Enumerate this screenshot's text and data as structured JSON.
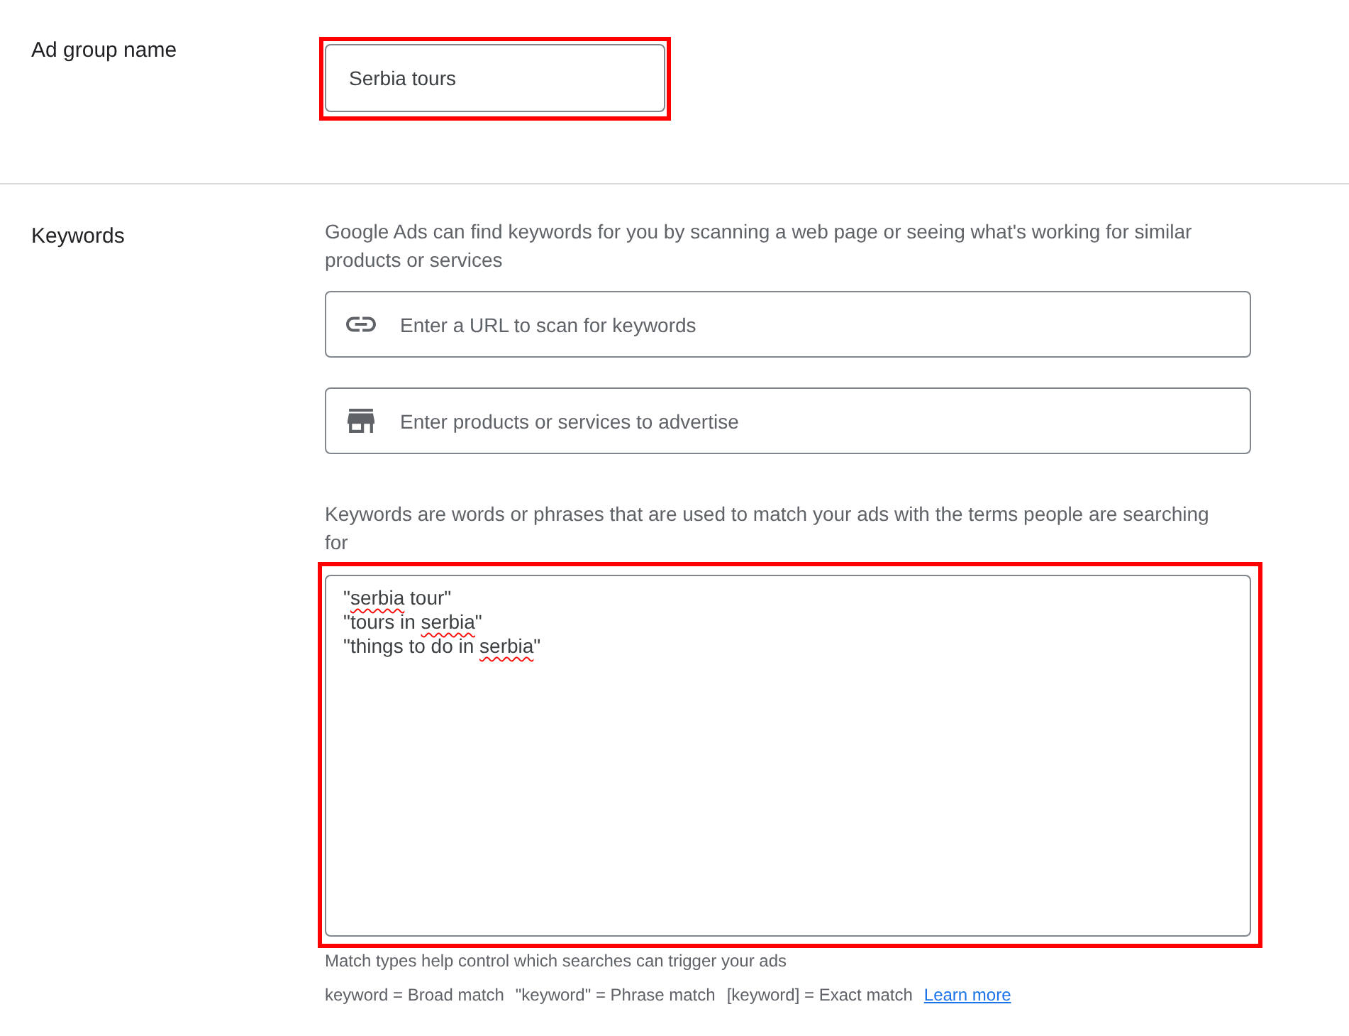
{
  "ad_group": {
    "label": "Ad group name",
    "value": "Serbia tours",
    "highlighted": true
  },
  "keywords": {
    "label": "Keywords",
    "description": "Google Ads can find keywords for you by scanning a web page or seeing what's working for similar products or services",
    "inputs": [
      {
        "kind": "url",
        "placeholder": "Enter a URL to scan for keywords"
      },
      {
        "kind": "products",
        "placeholder": "Enter products or services to advertise"
      }
    ],
    "hint": "Keywords are words or phrases that are used to match your ads with the terms people are searching for",
    "editor": {
      "highlighted": true,
      "lines": [
        [
          {
            "text": "\"",
            "misspelled": false
          },
          {
            "text": "serbia",
            "misspelled": true
          },
          {
            "text": " tour\"",
            "misspelled": false
          }
        ],
        [
          {
            "text": "\"tours in ",
            "misspelled": false
          },
          {
            "text": "serbia",
            "misspelled": true
          },
          {
            "text": "\"",
            "misspelled": false
          }
        ],
        [
          {
            "text": "\"things to do in ",
            "misspelled": false
          },
          {
            "text": "serbia",
            "misspelled": true
          },
          {
            "text": "\"",
            "misspelled": false
          }
        ]
      ]
    },
    "match_types": {
      "title": "Match types help control which searches can trigger your ads",
      "items": [
        "keyword = Broad match",
        "\"keyword\" = Phrase match",
        "[keyword] = Exact match"
      ],
      "link": "Learn more"
    }
  }
}
